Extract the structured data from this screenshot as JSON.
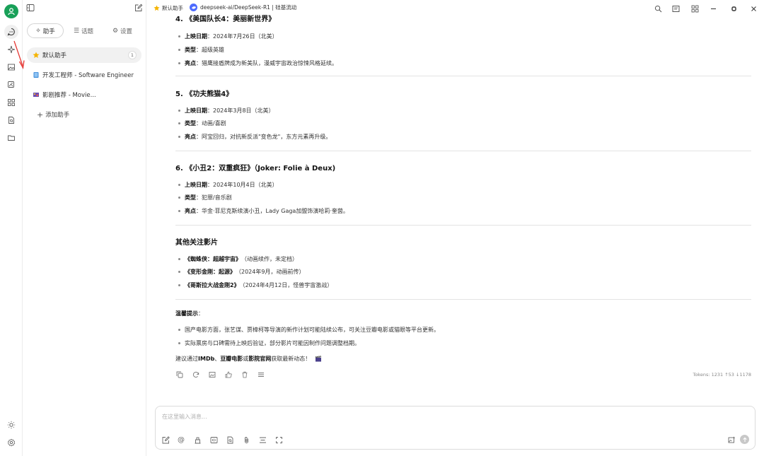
{
  "sidebar_tabs": [
    {
      "label": "助手",
      "icon": "sparkle-icon"
    },
    {
      "label": "话题",
      "icon": "list-icon"
    },
    {
      "label": "设置",
      "icon": "gear-icon"
    }
  ],
  "assistants": [
    {
      "emoji": "star-emoji",
      "name": "默认助手",
      "count": "1"
    },
    {
      "emoji": "book-emoji",
      "name": "开发工程师 - Software Engineer"
    },
    {
      "emoji": "film-emoji",
      "name": "影剧推荐 - Movie..."
    }
  ],
  "add_assistant": "添加助手",
  "topbar": {
    "assistant": "默认助手",
    "model": "deepseek-ai/DeepSeek-R1 | 硅基流动"
  },
  "content": {
    "movie4": {
      "title": "4. 《美国队长4：美丽新世界》",
      "date_label": "上映日期",
      "date": "：2024年7月26日（北美）",
      "type_label": "类型",
      "type": "：超级英雄",
      "highlight_label": "亮点",
      "highlight": "：猎鹰接盾牌成为新美队，漫威宇宙政治惊悚风格延续。"
    },
    "movie5": {
      "title": "5. 《功夫熊猫4》",
      "date_label": "上映日期",
      "date": "：2024年3月8日（北美）",
      "type_label": "类型",
      "type": "：动画/喜剧",
      "highlight_label": "亮点",
      "highlight": "：阿宝回归，对抗新反派\"变色龙\"，东方元素再升级。"
    },
    "movie6": {
      "title": "6. 《小丑2：双重疯狂》（Joker: Folie à Deux)",
      "date_label": "上映日期",
      "date": "：2024年10月4日（北美）",
      "type_label": "类型",
      "type": "：犯罪/音乐剧",
      "highlight_label": "亮点",
      "highlight": "：华金·菲尼克斯续演小丑，Lady Gaga加盟饰演哈莉·奎茵。"
    },
    "others": {
      "title": "其他关注影片",
      "items": [
        {
          "name": "《蜘蛛侠：超越宇宙》",
          "note": "（动画续作，未定档）"
        },
        {
          "name": "《变形金刚：起源》",
          "note": "（2024年9月，动画前传）"
        },
        {
          "name": "《哥斯拉大战金刚2》",
          "note": "（2024年4月12日，怪兽宇宙激战）"
        }
      ]
    },
    "tips": {
      "title": "温馨提示",
      "colon": "：",
      "items": [
        "国产电影方面，张艺谋、贾樟柯等导演的新作计划可能陆续公布，可关注豆瓣电影或猫眼等平台更新。",
        "实际票房与口碑需待上映后验证，部分影片可能因制作问题调整档期。"
      ]
    },
    "closing": {
      "pre": "建议通过",
      "b1": "IMDb",
      "sep1": "、",
      "b2": "豆瓣电影",
      "sep2": "或",
      "b3": "影院官网",
      "post": "获取最新动态！"
    }
  },
  "tokens": "Tokens: 1231 ↑53 ↓1178",
  "input": {
    "placeholder": "在这里输入消息..."
  },
  "colors": {
    "accent": "#18a058",
    "star": "#f5b400",
    "arrow": "#e53935"
  }
}
